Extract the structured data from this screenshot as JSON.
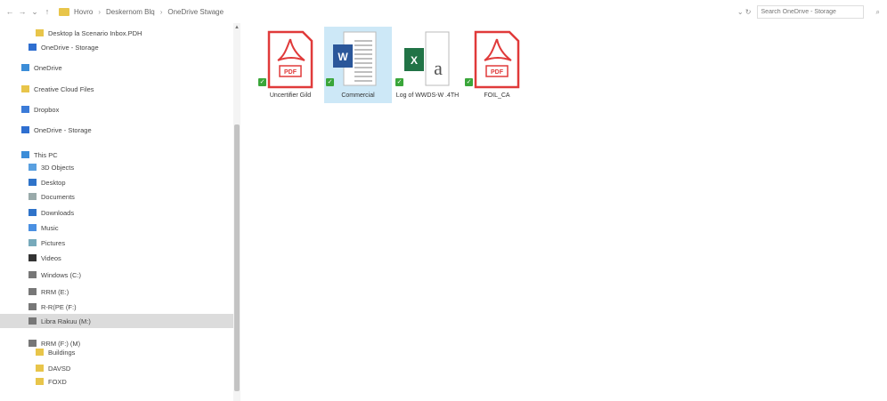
{
  "colors": {
    "folder": "#e8c54a",
    "onedrive": "#2f6fd0",
    "pdf": "#e03a3a",
    "word": "#2b579a",
    "excel": "#217346",
    "sync": "#3aa63a",
    "selection": "#cde8f7"
  },
  "toolbar": {
    "nav": [
      "←",
      "→",
      "⌄",
      "↑"
    ],
    "breadcrumbs": [
      "Hovro",
      "Deskernom Blq",
      "OneDrive Stwage"
    ],
    "separator": "›",
    "refresh_icon": "⌄  ↻",
    "search_placeholder": "Search OneDrive - Storage",
    "search_icon": "⌕"
  },
  "sidebar": {
    "items": [
      {
        "label": "Desktop la Scenario Inbox.PDH",
        "icon": "folder-icon"
      },
      {
        "label": "OneDrive - Storage",
        "icon": "onedrive-icon"
      },
      {
        "label": "OneDrive",
        "icon": "pc-icon"
      },
      {
        "label": "Creative Cloud Files",
        "icon": "folder-icon"
      },
      {
        "label": "Dropbox",
        "icon": "dropbox-icon"
      },
      {
        "label": "OneDrive - Storage",
        "icon": "onedrive-icon"
      },
      {
        "label": "This PC",
        "icon": "pc-icon"
      },
      {
        "label": "3D Objects",
        "icon": "objects-icon"
      },
      {
        "label": "Desktop",
        "icon": "desktop-icon"
      },
      {
        "label": "Documents",
        "icon": "doc-icon"
      },
      {
        "label": "Downloads",
        "icon": "download-icon"
      },
      {
        "label": "Music",
        "icon": "music-icon"
      },
      {
        "label": "Pictures",
        "icon": "pictures-icon"
      },
      {
        "label": "Videos",
        "icon": "video-icon"
      },
      {
        "label": "Windows (C:)",
        "icon": "drive-icon"
      },
      {
        "label": "RRM (E:)",
        "icon": "drive-icon"
      },
      {
        "label": "R-R(PE (F:)",
        "icon": "drive-icon"
      },
      {
        "label": "Libra Rakuu (M:)",
        "icon": "drive-icon"
      },
      {
        "label": "RRM (F:) (M)",
        "icon": "drive-icon"
      },
      {
        "label": "Buildings",
        "icon": "folder-icon"
      },
      {
        "label": "DAVSD",
        "icon": "folder-icon"
      },
      {
        "label": "FOXD",
        "icon": "folder-icon"
      }
    ]
  },
  "files": [
    {
      "name": "Uncertifier Gild",
      "type": "pdf",
      "badge": "PDF"
    },
    {
      "name": "Commercial",
      "type": "word",
      "badge": "W"
    },
    {
      "name": "Log of WWDS-W .4TH",
      "type": "excel",
      "badge": "X",
      "extra": "a"
    },
    {
      "name": "FOIL_CA",
      "type": "pdf",
      "badge": "PDF"
    }
  ],
  "scrollbar": {
    "up_arrow": "▲"
  },
  "sync_mark": "✓"
}
